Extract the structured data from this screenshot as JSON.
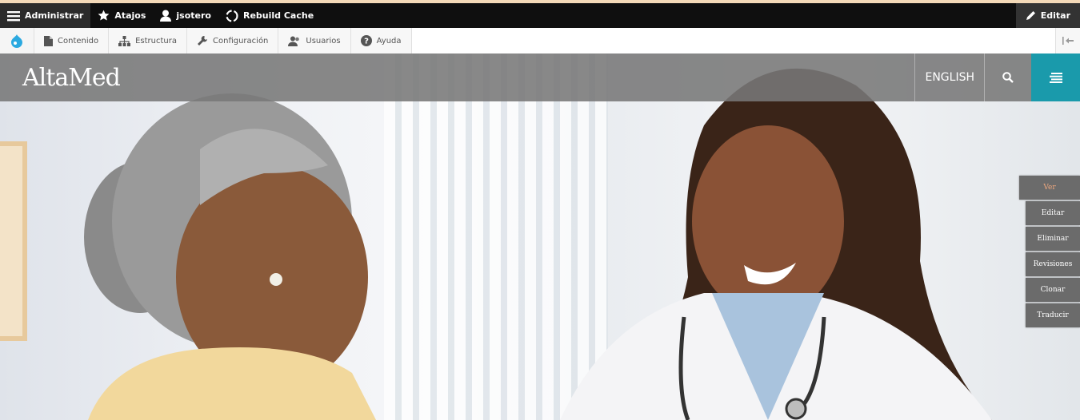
{
  "admin_bar": {
    "items": [
      {
        "label": "Administrar",
        "icon": "hamburger-icon"
      },
      {
        "label": "Atajos",
        "icon": "star-icon"
      },
      {
        "label": "jsotero",
        "icon": "user-icon"
      },
      {
        "label": "Rebuild Cache",
        "icon": "recycle-icon"
      }
    ],
    "edit_label": "Editar"
  },
  "tray": {
    "items": [
      {
        "label": "Contenido",
        "icon": "file-icon"
      },
      {
        "label": "Estructura",
        "icon": "sitemap-icon"
      },
      {
        "label": "Configuración",
        "icon": "wrench-icon"
      },
      {
        "label": "Usuarios",
        "icon": "users-icon"
      },
      {
        "label": "Ayuda",
        "icon": "help-icon"
      }
    ]
  },
  "header": {
    "logo": "AltaMed",
    "language": "ENGLISH"
  },
  "tasks": {
    "ver": "Ver",
    "items": [
      "Editar",
      "Eliminar",
      "Revisiones",
      "Clonar",
      "Traducir"
    ]
  },
  "colors": {
    "admin_bg": "#0f0f0f",
    "header_overlay": "#787878",
    "menu_accent": "#1a9aab",
    "task_bg": "#6b6b6b",
    "task_active_text": "#f0a87e"
  }
}
